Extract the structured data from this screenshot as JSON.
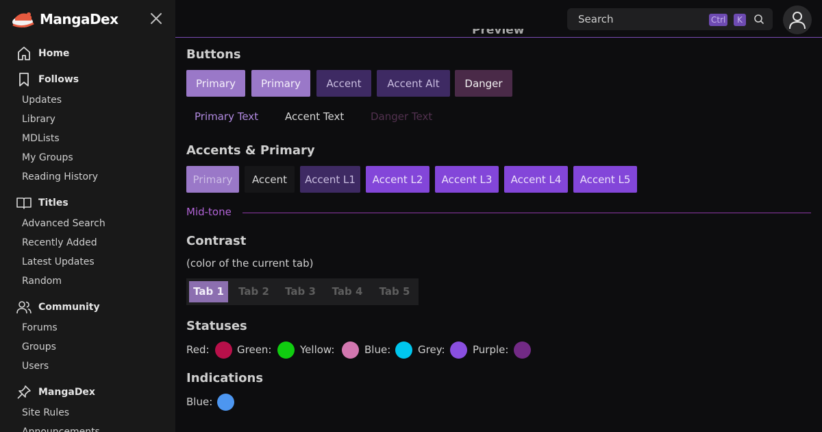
{
  "app": {
    "name": "MangaDex",
    "colors": {
      "accent": "#b163d6",
      "primary": "#9a78c8"
    }
  },
  "sidebar": {
    "sections": [
      {
        "label": "Home",
        "icon": "home-icon",
        "links": []
      },
      {
        "label": "Follows",
        "icon": "bookmark-icon",
        "links": [
          "Updates",
          "Library",
          "MDLists",
          "My Groups",
          "Reading History"
        ]
      },
      {
        "label": "Titles",
        "icon": "book-open-icon",
        "links": [
          "Advanced Search",
          "Recently Added",
          "Latest Updates",
          "Random"
        ]
      },
      {
        "label": "Community",
        "icon": "users-icon",
        "links": [
          "Forums",
          "Groups",
          "Users"
        ]
      },
      {
        "label": "MangaDex",
        "icon": "pin-icon",
        "links": [
          "Site Rules",
          "Announcements"
        ]
      }
    ]
  },
  "topbar": {
    "search_placeholder": "Search",
    "shortcut_ctrl": "Ctrl",
    "shortcut_key": "K"
  },
  "main": {
    "preview_heading": "Preview",
    "buttons_heading": "Buttons",
    "buttons": [
      {
        "label": "Primary",
        "bg": "#9a78c8",
        "fg": "#f5f0fb"
      },
      {
        "label": "Primary",
        "bg": "#9a78c8",
        "fg": "#f5f0fb"
      },
      {
        "label": "Accent",
        "bg": "#3e2a63",
        "fg": "#c9bde0"
      },
      {
        "label": "Accent Alt",
        "bg": "#3e2a63",
        "fg": "#c9bde0"
      },
      {
        "label": "Danger",
        "bg": "#4a2a48",
        "fg": "#f2f2f2"
      }
    ],
    "text_buttons": [
      {
        "label": "Primary Text",
        "color": "#b18ae0"
      },
      {
        "label": "Accent Text",
        "color": "#d8d8d8"
      },
      {
        "label": "Danger Text",
        "color": "#52314f"
      }
    ],
    "accents_heading": "Accents & Primary",
    "accents": [
      {
        "label": "Primary",
        "bg": "#9a78c8",
        "fg": "#cdbde6"
      },
      {
        "label": "Accent",
        "bg": "#161618",
        "fg": "#d8d8d8"
      },
      {
        "label": "Accent L1",
        "bg": "#3e2a63",
        "fg": "#c9bde0"
      },
      {
        "label": "Accent L2",
        "bg": "#8346d9",
        "fg": "#ece2fb"
      },
      {
        "label": "Accent L3",
        "bg": "#8346d9",
        "fg": "#ece2fb"
      },
      {
        "label": "Accent L4",
        "bg": "#8346d9",
        "fg": "#ece2fb"
      },
      {
        "label": "Accent L5",
        "bg": "#8346d9",
        "fg": "#ece2fb"
      }
    ],
    "midtone_label": "Mid-tone",
    "contrast_heading": "Contrast",
    "contrast_note": "(color of the current tab)",
    "tabs": [
      "Tab 1",
      "Tab 2",
      "Tab 3",
      "Tab 4",
      "Tab 5"
    ],
    "active_tab": "Tab 1",
    "statuses_heading": "Statuses",
    "statuses": [
      {
        "label": "Red:",
        "color": "#b8104a"
      },
      {
        "label": "Green:",
        "color": "#10cc10"
      },
      {
        "label": "Yellow:",
        "color": "#d277b0"
      },
      {
        "label": "Blue:",
        "color": "#00c6ee"
      },
      {
        "label": "Grey:",
        "color": "#8a4fe0"
      },
      {
        "label": "Purple:",
        "color": "#722a85"
      }
    ],
    "indications_heading": "Indications",
    "indications": [
      {
        "label": "Blue:",
        "color": "#4d96f0"
      }
    ]
  }
}
